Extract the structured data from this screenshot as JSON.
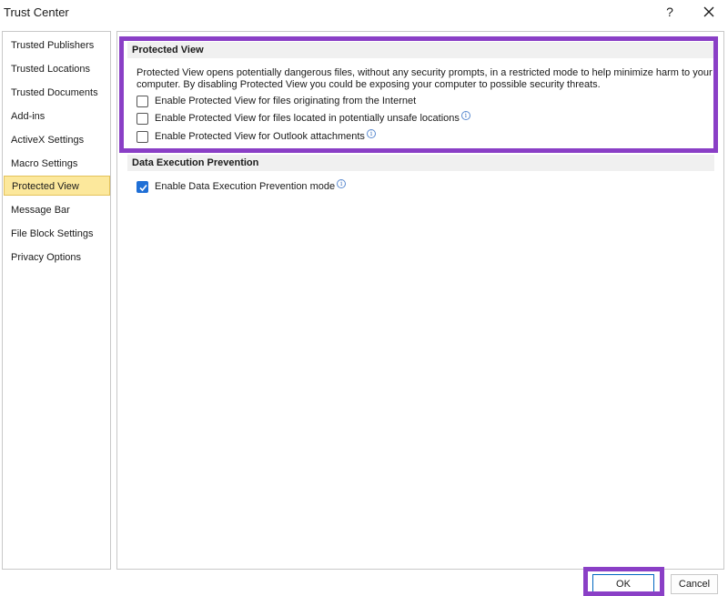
{
  "window": {
    "title": "Trust Center",
    "help_label": "?",
    "close_icon": "close-icon"
  },
  "sidebar": {
    "items": [
      {
        "label": "Trusted Publishers",
        "active": false
      },
      {
        "label": "Trusted Locations",
        "active": false
      },
      {
        "label": "Trusted Documents",
        "active": false
      },
      {
        "label": "Add-ins",
        "active": false
      },
      {
        "label": "ActiveX Settings",
        "active": false
      },
      {
        "label": "Macro Settings",
        "active": false
      },
      {
        "label": "Protected View",
        "active": true
      },
      {
        "label": "Message Bar",
        "active": false
      },
      {
        "label": "File Block Settings",
        "active": false
      },
      {
        "label": "Privacy Options",
        "active": false
      }
    ]
  },
  "protected_view": {
    "header": "Protected View",
    "description": "Protected View opens potentially dangerous files, without any security prompts, in a restricted mode to help minimize harm to your computer. By disabling Protected View you could be exposing your computer to possible security threats.",
    "options": [
      {
        "label": "Enable Protected View for files originating from the Internet",
        "checked": false,
        "info": false
      },
      {
        "label": "Enable Protected View for files located in potentially unsafe locations",
        "checked": false,
        "info": true
      },
      {
        "label": "Enable Protected View for Outlook attachments",
        "checked": false,
        "info": true
      }
    ]
  },
  "dep": {
    "header": "Data Execution Prevention",
    "option_label": "Enable Data Execution Prevention mode",
    "checked": true
  },
  "buttons": {
    "ok": "OK",
    "cancel": "Cancel"
  },
  "colors": {
    "highlight": "#8a3fc6",
    "active_nav": "#fce89c",
    "checkbox_checked": "#1f6fd6"
  }
}
